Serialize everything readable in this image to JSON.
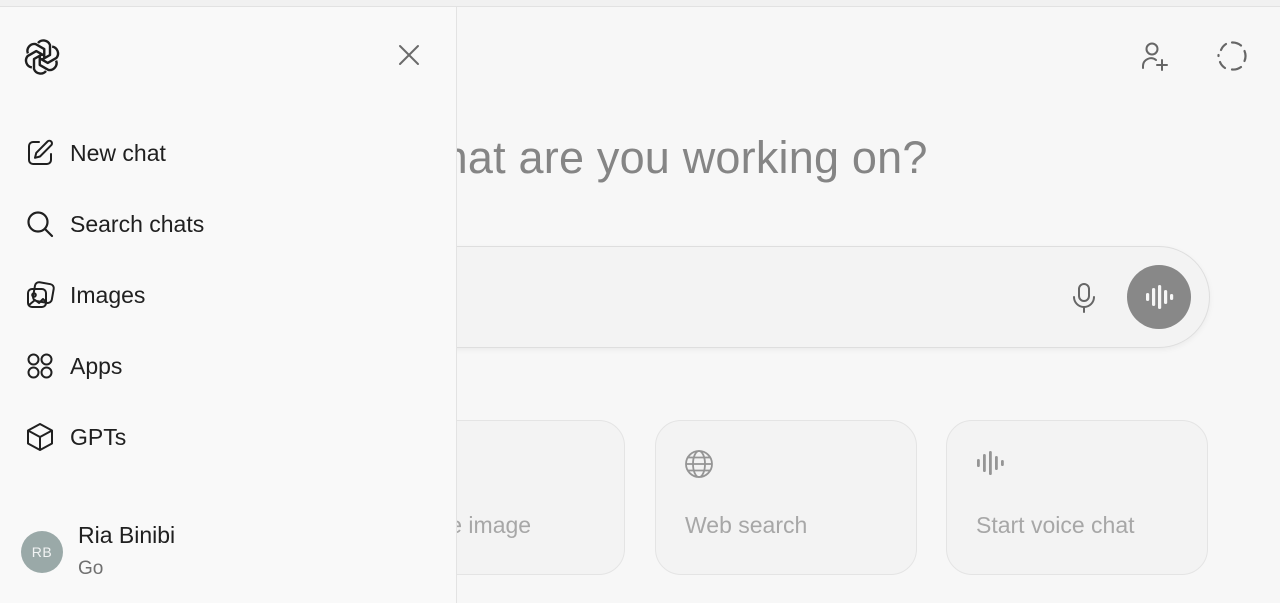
{
  "header": {
    "add_people_icon": "person-plus-icon",
    "temporary_chat_icon": "dashed-circle-icon"
  },
  "main": {
    "hero_text": "What are you working on?",
    "composer": {
      "mic_icon": "microphone-icon",
      "voice_icon": "voice-waveform-icon"
    },
    "cards": [
      {
        "label": "Create image",
        "icon": "image-icon"
      },
      {
        "label": "Web search",
        "icon": "globe-icon"
      },
      {
        "label": "Start voice chat",
        "icon": "voice-waveform-icon"
      }
    ]
  },
  "sidebar": {
    "logo_icon": "openai-logo-icon",
    "close_icon": "close-icon",
    "items": [
      {
        "label": "New chat",
        "icon": "edit-icon"
      },
      {
        "label": "Search chats",
        "icon": "search-icon"
      },
      {
        "label": "Images",
        "icon": "images-icon"
      },
      {
        "label": "Apps",
        "icon": "apps-grid-icon"
      },
      {
        "label": "GPTs",
        "icon": "cube-icon"
      }
    ],
    "user": {
      "initials": "RB",
      "name": "Ria Binibi",
      "plan": "Go"
    }
  },
  "colors": {
    "sidebar_bg": "#f9f9f9",
    "voice_button_bg": "#8d8d8d",
    "avatar_bg": "#9aa9a8",
    "muted_text": "#adadad"
  }
}
